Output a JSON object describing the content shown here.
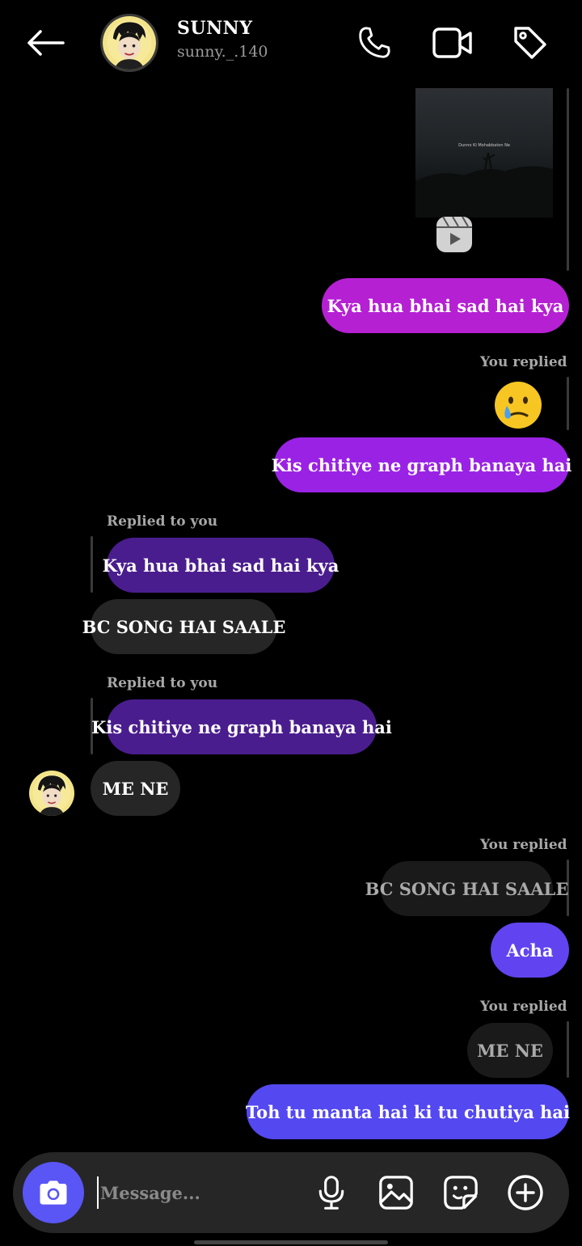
{
  "header": {
    "name": "SUNNY",
    "handle": "sunny._.140"
  },
  "reel": {
    "caption": "Dunno Ki Mohabbaton Ne"
  },
  "messages": [
    {
      "text": "Kya hua bhai sad hai kya"
    },
    {
      "label": "You replied"
    },
    {
      "text": "Kis chitiye ne graph banaya hai"
    },
    {
      "label": "Replied to you",
      "quote": "Kya hua bhai sad hai kya",
      "text": "BC SONG HAI SAALE"
    },
    {
      "label": "Replied to you",
      "quote": "Kis chitiye ne graph banaya hai",
      "text": "ME NE"
    },
    {
      "label": "You replied",
      "quote": "BC SONG HAI SAALE",
      "text": "Acha"
    },
    {
      "label": "You replied",
      "quote": "ME NE",
      "text": "Toh tu manta hai ki tu chutiya hai"
    }
  ],
  "composer": {
    "placeholder": "Message..."
  },
  "colors": {
    "bubble_purple_1": "#b520d3",
    "bubble_purple_2": "#9a22e4",
    "bubble_blue": "#5448f0",
    "bubble_gray": "#262626",
    "camera_button": "#5a55f5"
  },
  "icons": [
    "back-arrow-icon",
    "phone-icon",
    "video-camera-icon",
    "tag-icon",
    "reels-icon",
    "camera-icon",
    "microphone-icon",
    "gallery-icon",
    "sticker-icon",
    "plus-circle-icon"
  ]
}
